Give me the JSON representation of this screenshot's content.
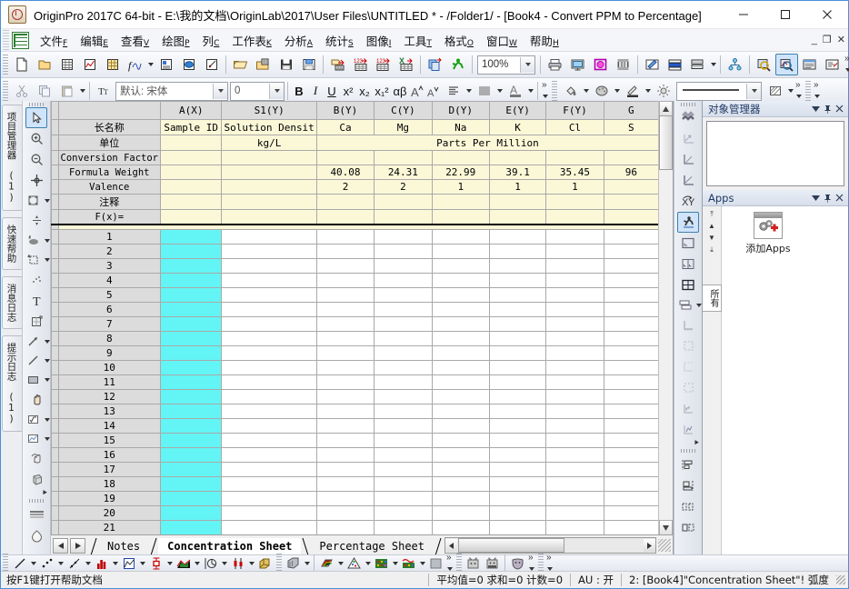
{
  "window": {
    "title": "OriginPro 2017C 64-bit - E:\\我的文档\\OriginLab\\2017\\User Files\\UNTITLED * - /Folder1/ - [Book4 - Convert PPM to Percentage]",
    "icon": "origin-logo-icon",
    "minimize_label": "—",
    "maximize_label": "▢",
    "close_label": "✕"
  },
  "menu": {
    "items": [
      {
        "label": "文件",
        "accel": "F"
      },
      {
        "label": "编辑",
        "accel": "E"
      },
      {
        "label": "查看",
        "accel": "V"
      },
      {
        "label": "绘图",
        "accel": "P"
      },
      {
        "label": "列",
        "accel": "C"
      },
      {
        "label": "工作表",
        "accel": "K"
      },
      {
        "label": "分析",
        "accel": "A"
      },
      {
        "label": "统计",
        "accel": "S"
      },
      {
        "label": "图像",
        "accel": "I"
      },
      {
        "label": "工具",
        "accel": "T"
      },
      {
        "label": "格式",
        "accel": "O"
      },
      {
        "label": "窗口",
        "accel": "W"
      },
      {
        "label": "帮助",
        "accel": "H"
      }
    ],
    "mdi_minimize": "_",
    "mdi_restore": "❐",
    "mdi_close": "✕"
  },
  "toolbar_standard": {
    "zoom_value": "100%",
    "buttons": [
      "new-project-icon",
      "new-folder-icon",
      "new-workbook-icon",
      "new-graph-icon",
      "new-matrix-icon",
      "new-function-plot-icon",
      "new-layout-icon",
      "new-notes-icon",
      "new-excel-icon",
      "open-project-icon",
      "open-excel-icon",
      "save-project-icon",
      "save-template-icon",
      "import-wizard-icon",
      "import-single-ascii-icon",
      "import-multiple-ascii-icon",
      "import-excel-icon",
      "duplicate-icon",
      "run-script-icon",
      "print-icon",
      "print-preview-icon",
      "export-graph-icon",
      "export-video-icon",
      "annotation-icon",
      "layer-contents-icon",
      "merge-graph-icon",
      "hierarchy-icon",
      "zoom-in-icon",
      "data-reader-icon",
      "results-log-icon",
      "command-window-icon"
    ]
  },
  "toolbar_format": {
    "font_name": "默认: 宋体",
    "font_size": "0",
    "bold_label": "B",
    "italic_label": "I",
    "underline_label": "U",
    "superscript_label": "x²",
    "subscript_label": "x₂",
    "supersub_label": "x₁²",
    "greek_label": "αβ",
    "increase_font_label": "A",
    "decrease_font_label": "A",
    "buttons": [
      "cut-icon",
      "copy-icon",
      "paste-icon",
      "align-icon",
      "columns-icon",
      "font-color-icon",
      "fill-color-icon",
      "palette-icon",
      "line-color-icon",
      "lighting-icon",
      "line-style-icon",
      "pattern-icon"
    ]
  },
  "left_vtabs": [
    {
      "label": "项目管理器 (1)",
      "name": "project-explorer"
    },
    {
      "label": "快速帮助",
      "name": "quick-help"
    },
    {
      "label": "消息日志",
      "name": "message-log"
    },
    {
      "label": "提示日志 (1)",
      "name": "prompt-log"
    }
  ],
  "left_tools": [
    "pointer-icon",
    "zoom-in-icon",
    "zoom-out-icon",
    "screen-reader-icon",
    "data-selector-icon",
    "data-reader-icon",
    "draw-data-icon",
    "regional-mask-icon",
    "scatter-icon",
    "text-tool-icon",
    "arrow-region-icon",
    "arrow-icon",
    "line-icon",
    "rectangle-icon",
    "hand-icon",
    "equation-icon",
    "image-icon",
    "rotate-icon",
    "3d-rotate-icon"
  ],
  "right_tools": [
    "style-translation-icon",
    "rescale-icon",
    "axis-left-icon",
    "axis-bottom-icon",
    "exchange-xy-icon",
    "run-script-icon",
    "new-layer-icon",
    "two-panel-icon",
    "four-panel-icon",
    "merge-icon",
    "layer-bottom-icon",
    "layer-top-icon",
    "layer-left-icon",
    "layer-right-icon",
    "axis-step-icon",
    "axis-plot-icon",
    "align-left-icon",
    "align-bottom-icon",
    "distribute-h-icon",
    "distribute-v-icon"
  ],
  "worksheet": {
    "columns": [
      "A(X)",
      "S1(Y)",
      "B(Y)",
      "C(Y)",
      "D(Y)",
      "E(Y)",
      "F(Y)",
      "G"
    ],
    "header_rows": [
      {
        "label": "长名称",
        "cjk": true,
        "values": [
          "Sample ID",
          "Solution Densit",
          "Ca",
          "Mg",
          "Na",
          "K",
          "Cl",
          "S"
        ]
      },
      {
        "label": "单位",
        "cjk": true,
        "values": [
          "",
          "kg/L",
          "",
          "",
          "",
          "",
          "",
          ""
        ],
        "merged_text": "Parts Per Million",
        "merged_from": 2
      },
      {
        "label": "Conversion Factor",
        "cjk": false,
        "values": [
          "",
          "",
          "",
          "",
          "",
          "",
          "",
          ""
        ]
      },
      {
        "label": "Formula Weight",
        "cjk": false,
        "values": [
          "",
          "",
          "40.08",
          "24.31",
          "22.99",
          "39.1",
          "35.45",
          "96"
        ]
      },
      {
        "label": "Valence",
        "cjk": false,
        "values": [
          "",
          "",
          "2",
          "2",
          "1",
          "1",
          "1",
          ""
        ]
      },
      {
        "label": "注释",
        "cjk": true,
        "values": [
          "",
          "",
          "",
          "",
          "",
          "",
          "",
          ""
        ]
      },
      {
        "label": "F(x)=",
        "cjk": false,
        "values": [
          "",
          "",
          "",
          "",
          "",
          "",
          "",
          ""
        ]
      }
    ],
    "row_numbers": [
      1,
      2,
      3,
      4,
      5,
      6,
      7,
      8,
      9,
      10,
      11,
      12,
      13,
      14,
      15,
      16,
      17,
      18,
      19,
      20,
      21
    ],
    "selected_column_index": 0,
    "selection_color": "#63f5f5",
    "meta_bg_color": "#fbf8d8"
  },
  "sheet_tabs": {
    "prev_label": "◄",
    "next_label": "►",
    "tabs": [
      {
        "label": "Notes",
        "active": false
      },
      {
        "label": "Concentration Sheet",
        "active": true
      },
      {
        "label": "Percentage Sheet",
        "active": false
      }
    ]
  },
  "right_panel": {
    "object_manager": {
      "title": "对象管理器",
      "menu_label": "▼",
      "pin_label": "⊥",
      "close_label": "✕",
      "content": ""
    },
    "apps": {
      "title": "Apps",
      "menu_label": "▼",
      "pin_label": "⊥",
      "close_label": "✕",
      "side_tab": "所有",
      "items": [
        {
          "label": "添加Apps",
          "icon": "add-apps-icon"
        }
      ],
      "nav": [
        "⤒",
        "▲",
        "▼",
        "⤓"
      ]
    }
  },
  "bottom_toolbar": {
    "buttons": [
      "line-plot-icon",
      "scatter-plot-icon",
      "line-symbol-icon",
      "column-bar-icon",
      "multi-curve-icon",
      "box-chart-icon",
      "area-chart-icon",
      "pie-chart-icon",
      "stock-chart-icon",
      "3d-bar-icon",
      "3d-surface-icon",
      "contour-icon",
      "ternary-icon",
      "image-plot-icon",
      "heatmap-icon",
      "fill-area-icon",
      "cat-icon",
      "cat2-icon",
      "mask-icon"
    ]
  },
  "statusbar": {
    "hint": "按F1键打开帮助文档",
    "stats": "平均值=0 求和=0 计数=0",
    "au": "AU : 开",
    "location": "2: [Book4]\"Concentration Sheet\"!  弧度"
  },
  "scrollbars": {
    "h_left_label": "◄",
    "h_right_label": "►",
    "v_up_label": "▲",
    "v_down_label": "▼"
  }
}
